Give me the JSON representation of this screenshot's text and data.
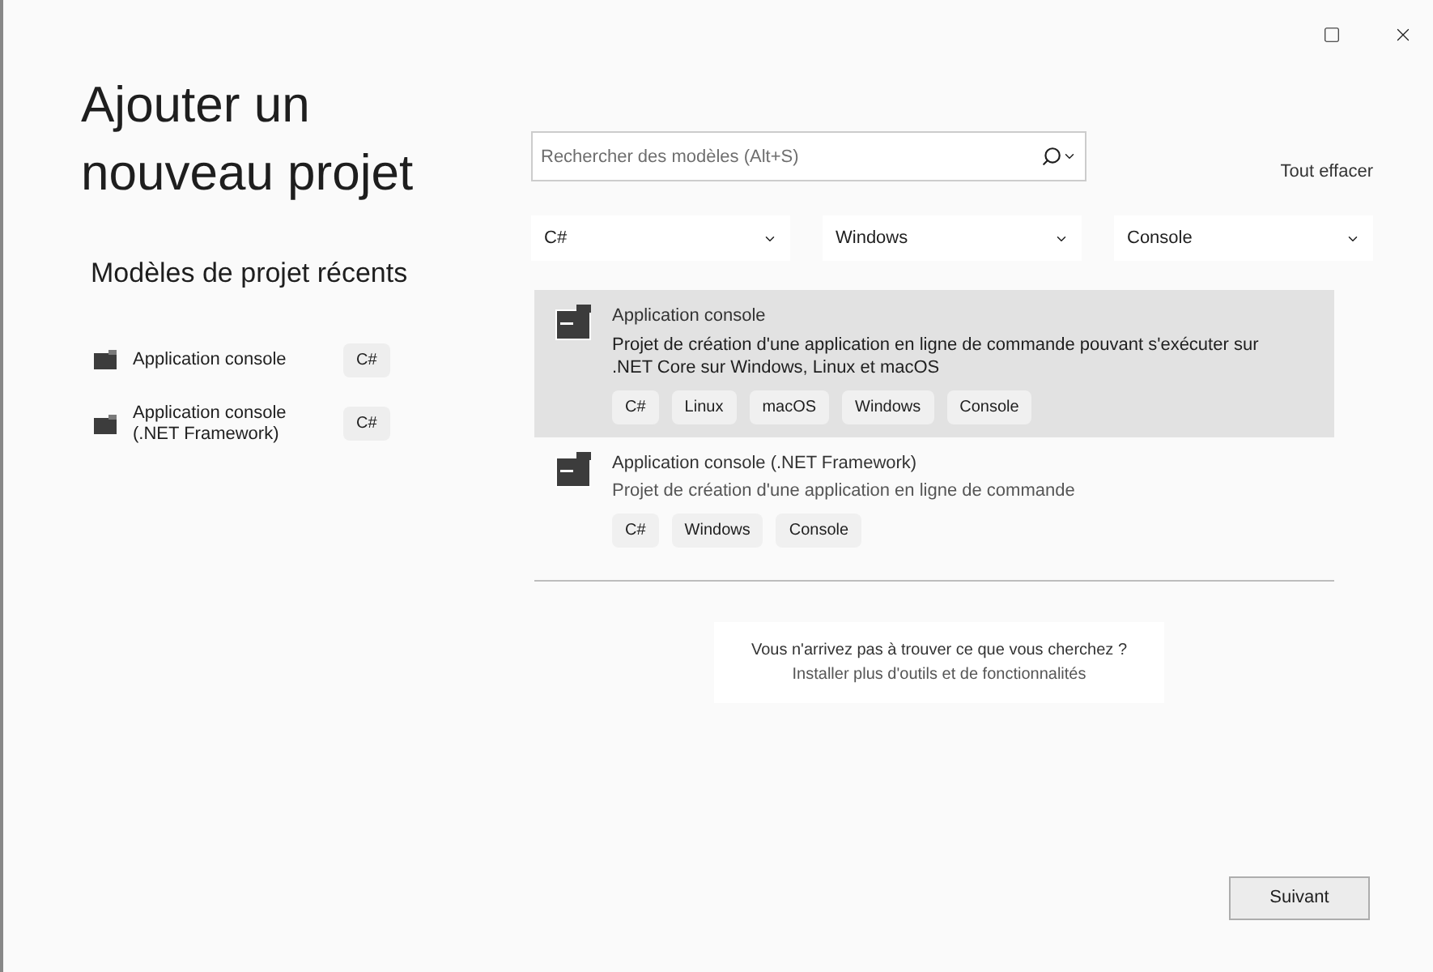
{
  "title": "Ajouter un nouveau projet",
  "recent": {
    "heading": "Modèles de projet récents",
    "items": [
      {
        "name": "Application console",
        "language": "C#"
      },
      {
        "name": "Application console (.NET Framework)",
        "language": "C#"
      }
    ]
  },
  "search": {
    "placeholder": "Rechercher des modèles (Alt+S)"
  },
  "clear_all": "Tout effacer",
  "filters": [
    {
      "value": "C#"
    },
    {
      "value": "Windows"
    },
    {
      "value": "Console"
    }
  ],
  "templates": [
    {
      "name": "Application console",
      "description": "Projet de création d'une application en ligne de commande pouvant s'exécuter sur .NET Core sur Windows, Linux et macOS",
      "tags": [
        "C#",
        "Linux",
        "macOS",
        "Windows",
        "Console"
      ],
      "selected": true
    },
    {
      "name": "Application console (.NET Framework)",
      "description": "Projet de création d'une application en ligne de commande",
      "tags": [
        "C#",
        "Windows",
        "Console"
      ],
      "selected": false
    }
  ],
  "help": {
    "question": "Vous n'arrivez pas à trouver ce que vous cherchez ?",
    "link": "Installer plus d'outils et de fonctionnalités"
  },
  "next_button": "Suivant"
}
